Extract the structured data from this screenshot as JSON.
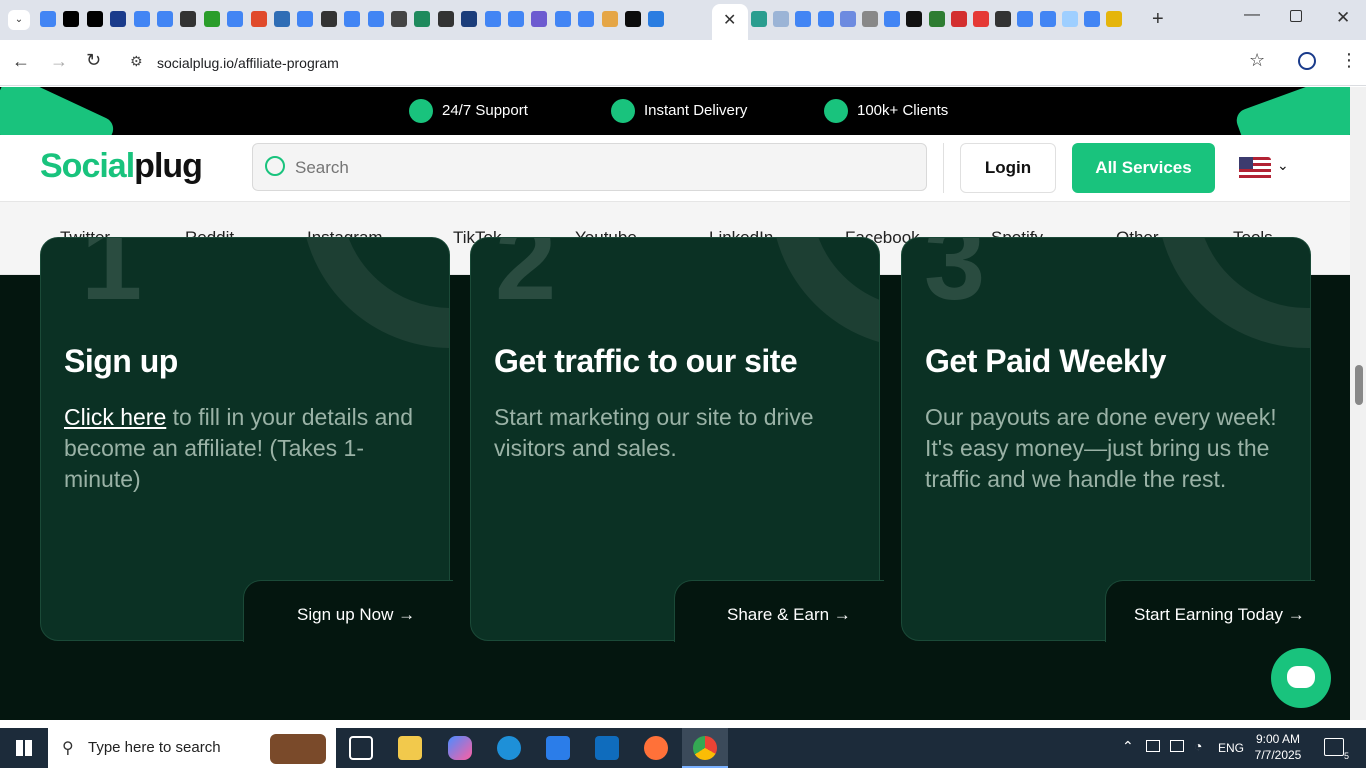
{
  "browser": {
    "url": "socialplug.io/affiliate-program",
    "tab_icon_colors": [
      "#4285f4",
      "#000",
      "#000",
      "#1a3b8b",
      "#4285f4",
      "#4285f4",
      "#333",
      "#2a9d2a",
      "#4285f4",
      "#e04a2b",
      "#2f6db5",
      "#4285f4",
      "#333",
      "#4285f4",
      "#4285f4",
      "#444",
      "#1f8a5d",
      "#333",
      "#1b3d7a",
      "#4285f4",
      "#4285f4",
      "#6d5bd0",
      "#4285f4",
      "#4285f4",
      "#e5a646",
      "#0c0c0c",
      "#2a7de1"
    ]
  },
  "topbar": {
    "items": [
      {
        "label": "24/7 Support",
        "icon": "chat-icon"
      },
      {
        "label": "Instant Delivery",
        "icon": "lightning-icon"
      },
      {
        "label": "100k+ Clients",
        "icon": "star-icon"
      }
    ]
  },
  "header": {
    "logo_part1": "Social",
    "logo_part2": "plug",
    "search_placeholder": "Search",
    "login_label": "Login",
    "all_services_label": "All Services"
  },
  "nav": {
    "items": [
      "Twitter",
      "Reddit",
      "Instagram",
      "TikTok",
      "Youtube",
      "LinkedIn",
      "Facebook",
      "Spotify",
      "Other",
      "Tools"
    ]
  },
  "cards": [
    {
      "number": "1",
      "title": "Sign up",
      "link_text": "Click here",
      "text": " to fill in your details and become an affiliate! (Takes 1-minute)",
      "cta": "Sign up Now"
    },
    {
      "number": "2",
      "title": "Get traffic to our site",
      "text": "Start marketing our site to drive visitors and sales.",
      "cta": "Share & Earn"
    },
    {
      "number": "3",
      "title": "Get Paid Weekly",
      "text": "Our payouts are done every week! It's easy money—just bring us the traffic and we handle the rest.",
      "cta": "Start Earning Today"
    }
  ],
  "taskbar": {
    "search_placeholder": "Type here to search",
    "language": "ENG",
    "time": "9:00 AM",
    "date": "7/7/2025",
    "notification_count": "5"
  },
  "colors": {
    "brand_green": "#19c37d",
    "page_bg": "#04160f",
    "card_bg": "#0b3124"
  }
}
